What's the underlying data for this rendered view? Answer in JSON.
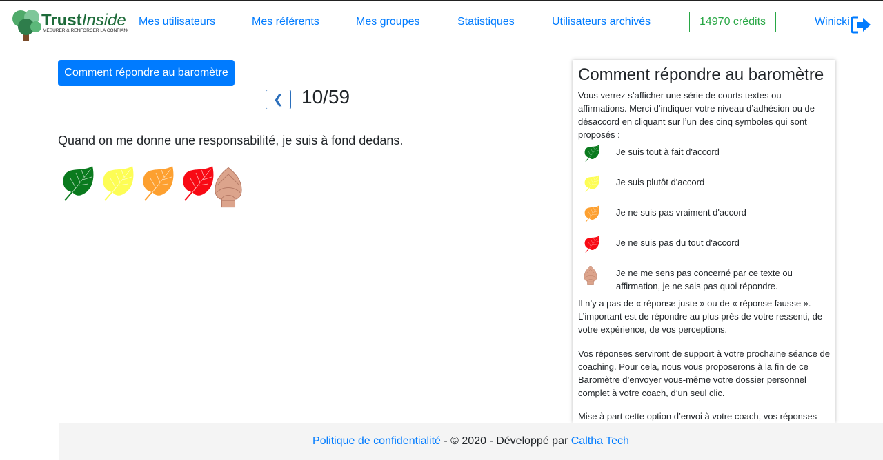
{
  "nav": {
    "logo_text": "TrustInside",
    "logo_tagline": "MESURER & RENFORCER LA CONFIANCE",
    "links": [
      "Mes utilisateurs",
      "Mes référents",
      "Mes groupes",
      "Statistiques",
      "Utilisateurs archivés"
    ],
    "credits": "14970 crédits",
    "user": "Winicki",
    "logout_icon": "sign-out-icon"
  },
  "main": {
    "help_button": "Comment répondre au baromètre",
    "counter": "10/59",
    "question": "Quand on me donne une responsabilité, je suis à fond dedans.",
    "answers": [
      {
        "icon": "green-leaf",
        "color": "#0a7a1e"
      },
      {
        "icon": "yellow-leaf",
        "color": "#fdfd55"
      },
      {
        "icon": "orange-leaf",
        "color": "#fda030"
      },
      {
        "icon": "red-leaf",
        "color": "#f80a14"
      },
      {
        "icon": "bud",
        "color": "#dca48c"
      }
    ]
  },
  "panel": {
    "title": "Comment répondre au baromètre",
    "intro": "Vous verrez s’afficher une série de courts textes ou affirmations. Merci d’indiquer votre niveau d’adhésion ou de désaccord en cliquant sur l’un des cinq symboles qui sont proposés :",
    "legend": [
      "Je suis tout à fait d'accord",
      "Je suis plutôt d'accord",
      "Je ne suis pas vraiment d'accord",
      "Je ne suis pas du tout d'accord",
      "Je ne me sens pas concerné par ce texte ou affirmation, je ne sais pas quoi répondre."
    ],
    "p1": "Il n’y a pas de « réponse juste » ou de « réponse fausse ». L’important est de répondre au plus près de votre ressenti, de votre expérience, de vos perceptions.",
    "p2": "Vos réponses serviront de support à votre prochaine séance de coaching. Pour cela, nous vous proposerons à la fin de ce Baromètre d’envoyer vous-même votre dossier personnel complet à votre coach, d’un seul clic.",
    "p3": "Mise à part cette option d’envoi à votre coach, vos réponses"
  },
  "footer": {
    "privacy": "Politique de confidentialité",
    "middle": " - © 2020 - Développé par ",
    "company": "Caltha Tech"
  }
}
